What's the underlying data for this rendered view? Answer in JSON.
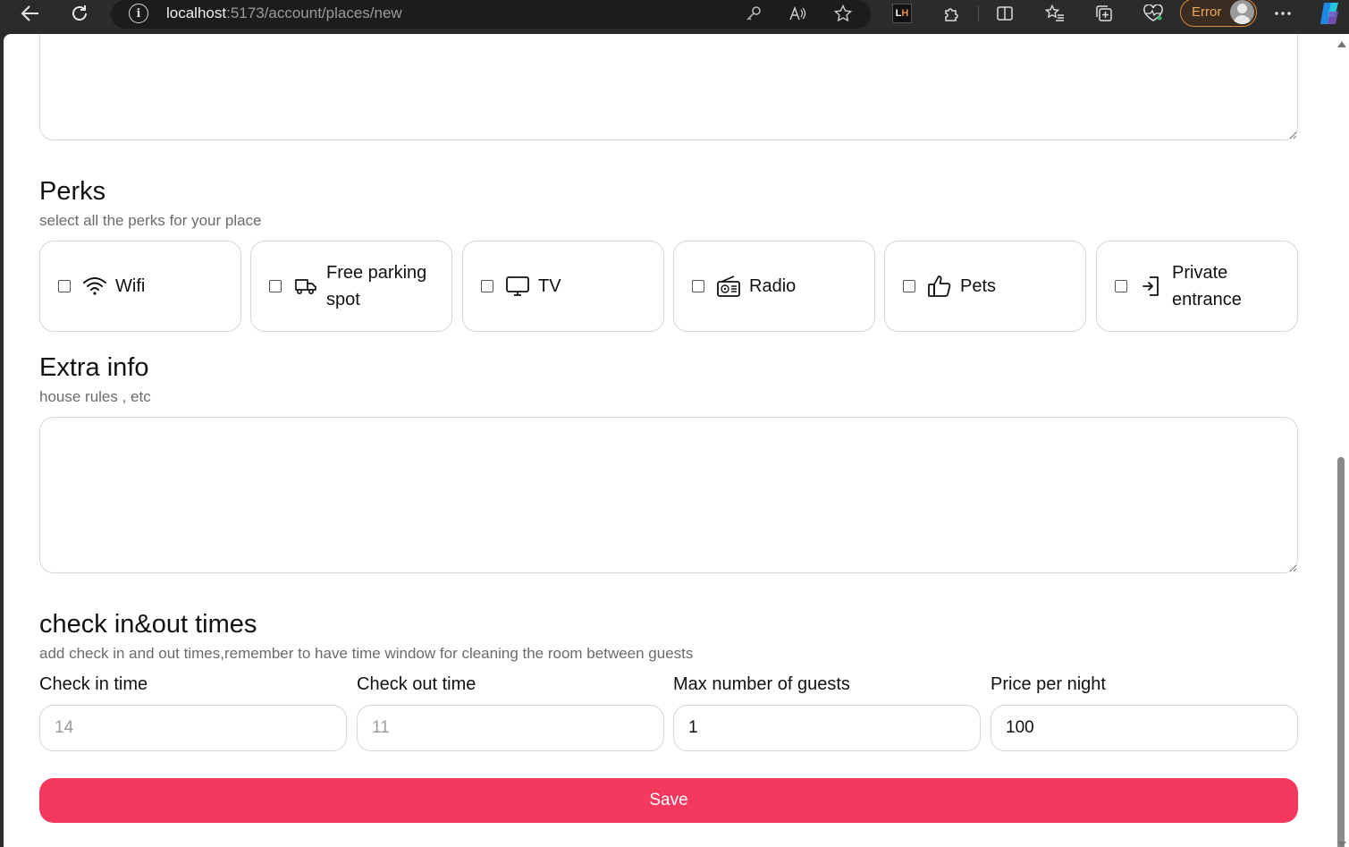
{
  "browser": {
    "url_host": "localhost",
    "url_path": ":5173/account/places/new",
    "profile_status": "Error",
    "extension_badge": {
      "left": "L",
      "right": "H"
    }
  },
  "form": {
    "perks_section": {
      "title": "Perks",
      "subtitle": "select all the perks for your place",
      "items": [
        {
          "label": "Wifi",
          "icon": "wifi-icon",
          "checked": false
        },
        {
          "label": "Free parking spot",
          "icon": "truck-icon",
          "checked": false
        },
        {
          "label": "TV",
          "icon": "tv-icon",
          "checked": false
        },
        {
          "label": "Radio",
          "icon": "radio-icon",
          "checked": false
        },
        {
          "label": "Pets",
          "icon": "thumbs-up-icon",
          "checked": false
        },
        {
          "label": "Private entrance",
          "icon": "entrance-icon",
          "checked": false
        }
      ]
    },
    "extra_info_section": {
      "title": "Extra info",
      "subtitle": "house rules , etc",
      "value": ""
    },
    "times_section": {
      "title": "check in&out times",
      "subtitle": "add check in and out times,remember to have time window for cleaning the room between guests",
      "fields": [
        {
          "label": "Check in time",
          "value": "",
          "placeholder": "14"
        },
        {
          "label": "Check out time",
          "value": "",
          "placeholder": "11"
        },
        {
          "label": "Max number of guests",
          "value": "1",
          "placeholder": ""
        },
        {
          "label": "Price per night",
          "value": "100",
          "placeholder": ""
        }
      ]
    },
    "save_label": "Save"
  },
  "colors": {
    "primary": "#f5385d",
    "border": "#d6d6d6",
    "subtitle": "#6b6b6b",
    "browser_chrome": "#2b2b2b",
    "error_accent": "#d98a3a"
  }
}
